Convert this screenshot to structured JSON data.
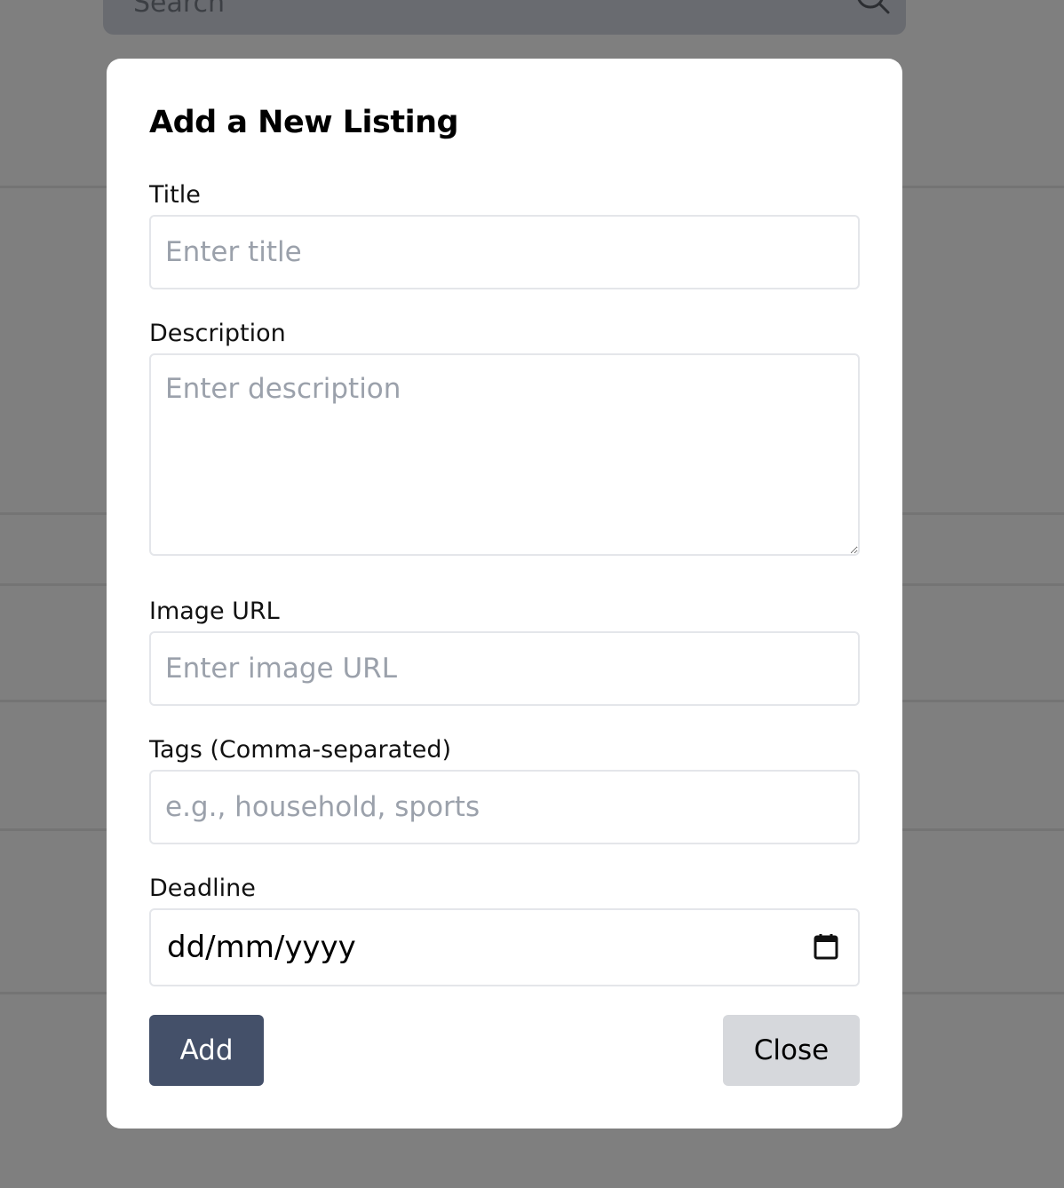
{
  "background": {
    "search_text": "Search",
    "search_icon": "search-icon",
    "overlay_color": "#7f7f7f"
  },
  "modal": {
    "title": "Add a New Listing",
    "fields": {
      "title": {
        "label": "Title",
        "placeholder": "Enter title"
      },
      "description": {
        "label": "Description",
        "placeholder": "Enter description"
      },
      "image_url": {
        "label": "Image URL",
        "placeholder": "Enter image URL"
      },
      "tags": {
        "label": "Tags (Comma-separated)",
        "placeholder": "e.g., household, sports"
      },
      "deadline": {
        "label": "Deadline",
        "value": "dd/mm/yyyy",
        "icon": "calendar-icon"
      }
    },
    "buttons": {
      "add": {
        "label": "Add",
        "color": "#445069"
      },
      "close": {
        "label": "Close",
        "color": "#d6d8dc"
      }
    }
  }
}
